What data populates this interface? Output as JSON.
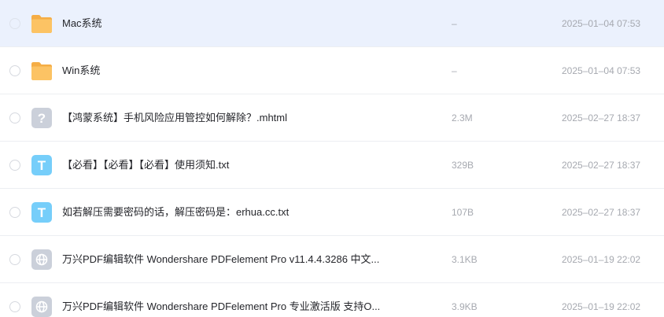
{
  "files": [
    {
      "name": "Mac系统",
      "size": "–",
      "date": "2025–01–04 07:53",
      "type": "folder",
      "selected": true
    },
    {
      "name": "Win系统",
      "size": "–",
      "date": "2025–01–04 07:53",
      "type": "folder",
      "selected": false
    },
    {
      "name": "【鸿蒙系统】手机风险应用管控如何解除？.mhtml",
      "size": "2.3M",
      "date": "2025–02–27 18:37",
      "type": "unknown",
      "selected": false
    },
    {
      "name": "【必看】【必看】【必看】使用须知.txt",
      "size": "329B",
      "date": "2025–02–27 18:37",
      "type": "text",
      "selected": false
    },
    {
      "name": "如若解压需要密码的话，解压密码是：erhua.cc.txt",
      "size": "107B",
      "date": "2025–02–27 18:37",
      "type": "text",
      "selected": false
    },
    {
      "name": "万兴PDF编辑软件 Wondershare PDFelement Pro v11.4.4.3286 中文...",
      "size": "3.1KB",
      "date": "2025–01–19 22:02",
      "type": "link",
      "selected": false
    },
    {
      "name": "万兴PDF编辑软件 Wondershare PDFelement Pro 专业激活版 支持O...",
      "size": "3.9KB",
      "date": "2025–01–19 22:02",
      "type": "link",
      "selected": false
    }
  ],
  "icons": {
    "folder": {
      "name": "folder-icon",
      "color": "#fcc364"
    },
    "unknown": {
      "name": "unknown-file-icon",
      "color": "#cbd0da",
      "glyph": "?"
    },
    "text": {
      "name": "text-file-icon",
      "color": "#76cefa",
      "glyph": "T"
    },
    "link": {
      "name": "web-link-icon",
      "color": "#cbd0da"
    }
  },
  "colors": {
    "selected_row": "#ebf1fd",
    "divider": "#eceef2",
    "primary_text": "#25262b",
    "secondary_text": "#a6a9b0"
  }
}
